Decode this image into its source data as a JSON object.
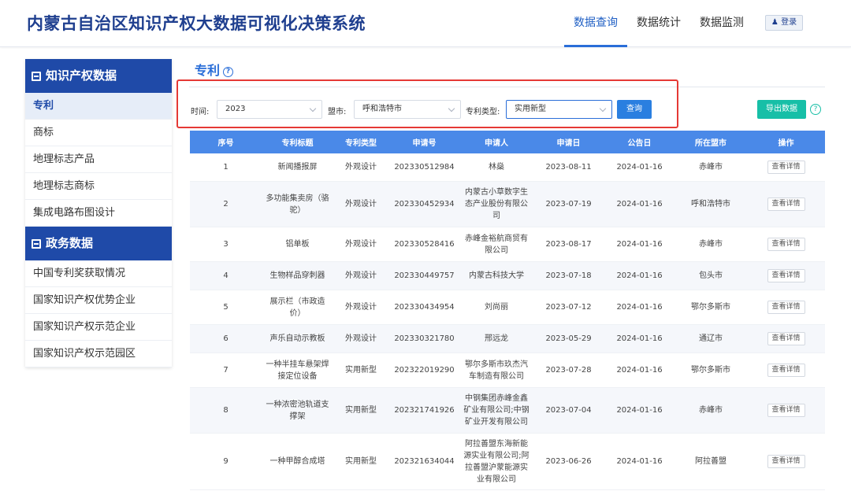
{
  "header": {
    "title": "内蒙古自治区知识产权大数据可视化决策系统",
    "nav": [
      {
        "label": "数据查询",
        "active": true
      },
      {
        "label": "数据统计",
        "active": false
      },
      {
        "label": "数据监测",
        "active": false
      }
    ],
    "login_label": "登录"
  },
  "sidebar": {
    "groups": [
      {
        "title": "知识产权数据",
        "items": [
          {
            "label": "专利",
            "active": true
          },
          {
            "label": "商标",
            "active": false
          },
          {
            "label": "地理标志产品",
            "active": false
          },
          {
            "label": "地理标志商标",
            "active": false
          },
          {
            "label": "集成电路布图设计",
            "active": false
          }
        ]
      },
      {
        "title": "政务数据",
        "items": [
          {
            "label": "中国专利奖获取情况",
            "active": false
          },
          {
            "label": "国家知识产权优势企业",
            "active": false
          },
          {
            "label": "国家知识产权示范企业",
            "active": false
          },
          {
            "label": "国家知识产权示范园区",
            "active": false
          }
        ]
      }
    ]
  },
  "section": {
    "title": "专利"
  },
  "filters": {
    "time_label": "时间:",
    "time_value": "2023",
    "city_label": "盟市:",
    "city_value": "呼和浩特市",
    "type_label": "专利类型:",
    "type_value": "实用新型",
    "query_label": "查询",
    "export_label": "导出数据"
  },
  "table": {
    "headers": [
      "序号",
      "专利标题",
      "专利类型",
      "申请号",
      "申请人",
      "申请日",
      "公告日",
      "所在盟市",
      "操作"
    ],
    "detail_label": "查看详情",
    "rows": [
      [
        "1",
        "新闻播报屏",
        "外观设计",
        "202330512984",
        "林燊",
        "2023-08-11",
        "2024-01-16",
        "赤峰市"
      ],
      [
        "2",
        "多功能集卖房（骆驼）",
        "外观设计",
        "202330452934",
        "内蒙古小草数字生态产业股份有限公司",
        "2023-07-19",
        "2024-01-16",
        "呼和浩特市"
      ],
      [
        "3",
        "铝单板",
        "外观设计",
        "202330528416",
        "赤峰金裕航商贸有限公司",
        "2023-08-17",
        "2024-01-16",
        "赤峰市"
      ],
      [
        "4",
        "生物样品穿刺器",
        "外观设计",
        "202330449757",
        "内蒙古科技大学",
        "2023-07-18",
        "2024-01-16",
        "包头市"
      ],
      [
        "5",
        "展示栏（市政造价）",
        "外观设计",
        "202330434954",
        "刘尚丽",
        "2023-07-12",
        "2024-01-16",
        "鄂尔多斯市"
      ],
      [
        "6",
        "声乐自动示教板",
        "外观设计",
        "202330321780",
        "邢远龙",
        "2023-05-29",
        "2024-01-16",
        "通辽市"
      ],
      [
        "7",
        "一种半挂车悬架焊接定位设备",
        "实用新型",
        "202322019290",
        "鄂尔多斯市玖杰汽车制造有限公司",
        "2023-07-28",
        "2024-01-16",
        "鄂尔多斯市"
      ],
      [
        "8",
        "一种浓密池轨道支撑架",
        "实用新型",
        "202321741926",
        "中钢集团赤峰金鑫矿业有限公司;中钢矿业开发有限公司",
        "2023-07-04",
        "2024-01-16",
        "赤峰市"
      ],
      [
        "9",
        "一种甲醇合成塔",
        "实用新型",
        "202321634044",
        "阿拉善盟东海新能源实业有限公司;阿拉善盟沪蒙能源实业有限公司",
        "2023-06-26",
        "2024-01-16",
        "阿拉善盟"
      ]
    ]
  }
}
